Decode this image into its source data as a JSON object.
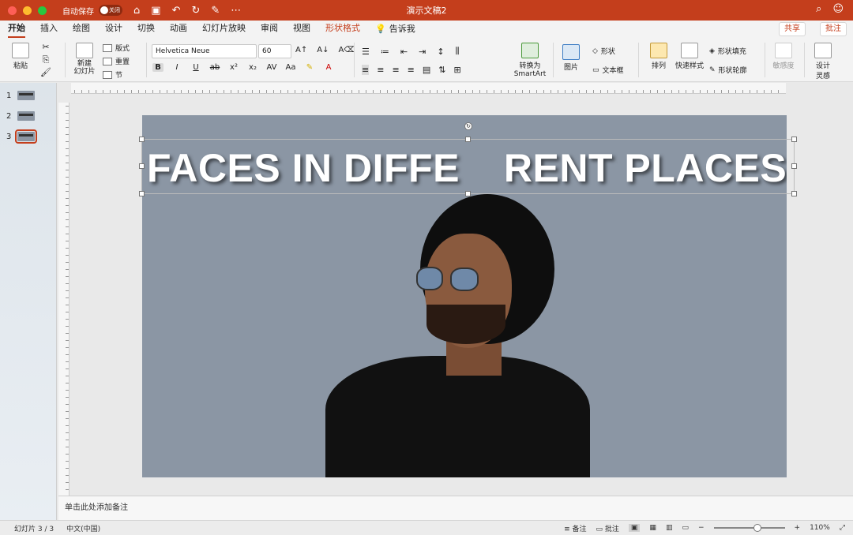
{
  "window": {
    "autosave_label": "自动保存",
    "autosave_state": "关闭",
    "doc_title": "演示文稿2"
  },
  "tabs": [
    "开始",
    "插入",
    "绘图",
    "设计",
    "切换",
    "动画",
    "幻灯片放映",
    "审阅",
    "视图",
    "形状格式"
  ],
  "tell_me": "告诉我",
  "share": "共享",
  "comments": "批注",
  "ribbon": {
    "paste": "粘贴",
    "new_slide": "新建\n幻灯片",
    "layout": "版式",
    "reset": "重置",
    "section": "节",
    "font_name": "Helvetica Neue",
    "font_size": "60",
    "convert_smartart_1": "转换为",
    "convert_smartart_2": "SmartArt",
    "picture": "图片",
    "shape": "形状",
    "textbox": "文本框",
    "arrange": "排列",
    "quick_styles": "快速样式",
    "shape_fill": "形状填充",
    "shape_outline": "形状轮廓",
    "sensitivity": "敏感度",
    "designer_1": "设计",
    "designer_2": "灵感"
  },
  "slides": [
    "1",
    "2",
    "3"
  ],
  "slide": {
    "title_left": "FACES IN DIFFE",
    "title_right": "RENT PLACES"
  },
  "notes_placeholder": "单击此处添加备注",
  "status": {
    "slide_count": "幻灯片 3 / 3",
    "language": "中文(中国)",
    "notes": "备注",
    "comments": "批注",
    "zoom": "110%"
  },
  "colors": {
    "accent": "#c43e1c",
    "slide_bg": "#8b96a4"
  }
}
